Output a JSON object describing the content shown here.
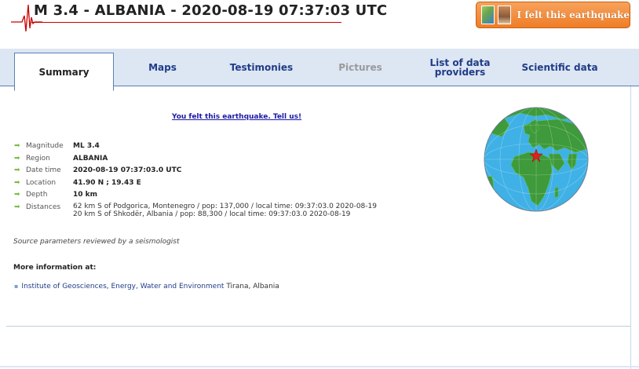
{
  "header": {
    "title": "M 3.4 - ALBANIA - 2020-08-19 07:37:03 UTC",
    "felt_button": "I felt this earthquake"
  },
  "tabs": [
    {
      "label": "Summary",
      "state": "active"
    },
    {
      "label": "Maps",
      "state": "normal"
    },
    {
      "label": "Testimonies",
      "state": "normal"
    },
    {
      "label": "Pictures",
      "state": "disabled"
    },
    {
      "label": "List of data providers",
      "state": "normal"
    },
    {
      "label": "Scientific data",
      "state": "normal"
    }
  ],
  "summary": {
    "felt_link": "You felt this earthquake. Tell us!",
    "params": {
      "magnitude": {
        "key": "Magnitude",
        "value": "ML 3.4"
      },
      "region": {
        "key": "Region",
        "value": "ALBANIA"
      },
      "datetime": {
        "key": "Date time",
        "value": "2020-08-19 07:37:03.0 UTC"
      },
      "location": {
        "key": "Location",
        "value": "41.90 N ; 19.43 E"
      },
      "depth": {
        "key": "Depth",
        "value": "10 km"
      },
      "distances": {
        "key": "Distances",
        "line1": "62 km S of Podgorica, Montenegro / pop: 137,000 / local time: 09:37:03.0 2020-08-19",
        "line2": "20 km S of Shkodër, Albania / pop: 88,300 / local time: 09:37:03.0 2020-08-19"
      }
    },
    "review": "Source parameters reviewed by a seismologist",
    "more_info_label": "More information at:",
    "institute": {
      "link": "Institute of Geosciences, Energy, Water and Environment",
      "suffix": " Tirana, Albania"
    }
  },
  "colors": {
    "tab_text": "#1f3c88",
    "tab_bar": "#dde6f3",
    "button": "#ef7d27",
    "ocean": "#3fb1e6",
    "land": "#3e9a3a",
    "epicenter": "#e02020"
  },
  "icons": {
    "logo": "seismogram-icon",
    "arrow": "green-arrow-icon",
    "epicenter": "red-star-icon"
  }
}
